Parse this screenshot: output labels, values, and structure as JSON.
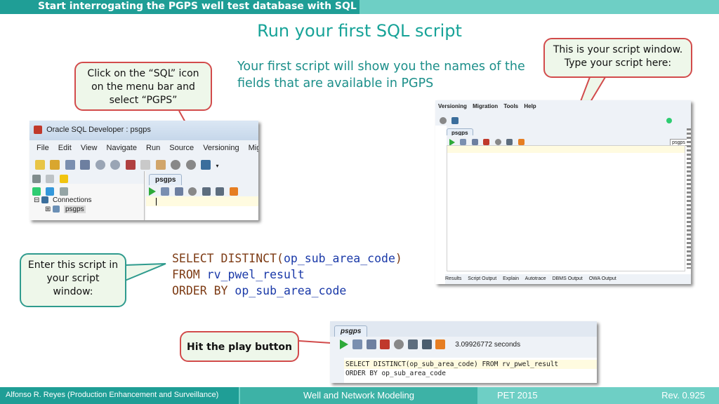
{
  "header": {
    "banner_title": "Start interrogating the PGPS well test database with SQL",
    "slide_title": "Run your first SQL script"
  },
  "intro_text": "Your first script will show you the names of the fields that are available in PGPS",
  "callouts": {
    "sql_icon": "Click on the “SQL” icon on the menu bar and select “PGPS”",
    "script_window": "This is your script window. Type your script here:",
    "enter_script": "Enter this script in your script window:",
    "play_button": "Hit the play button"
  },
  "sql_script": {
    "line1_kw": "SELECT DISTINCT(",
    "line1_field": "op_sub_area_code",
    "line1_end": ")",
    "line2_kw": "FROM ",
    "line2_table": "rv_pwel_result",
    "line3_kw": "ORDER BY ",
    "line3_field": "op_sub_area_code"
  },
  "left_screenshot": {
    "window_title": "Oracle SQL Developer : psgps",
    "menu": [
      "File",
      "Edit",
      "View",
      "Navigate",
      "Run",
      "Source",
      "Versioning",
      "Migration"
    ],
    "tab_label": "psgps",
    "tree_root": "Connections",
    "tree_child": "psgps"
  },
  "right_screenshot": {
    "menu": [
      "Versioning",
      "Migration",
      "Tools",
      "Help"
    ],
    "tab_label": "psgps",
    "connection_select": "psgps",
    "result_tabs": [
      "Results",
      "Script Output",
      "Explain",
      "Autotrace",
      "DBMS Output",
      "OWA Output"
    ]
  },
  "bottom_screenshot": {
    "tab_label": "psgps",
    "elapsed": "3.09926772 seconds",
    "code_line1": "SELECT DISTINCT(op_sub_area_code) FROM rv_pwel_result",
    "code_line2": "ORDER BY op_sub_area_code"
  },
  "footer": {
    "author": "Alfonso R. Reyes (Production Enhancement and Surveillance)",
    "course": "Well and Network Modeling",
    "event": "PET 2015",
    "revision": "Rev. 0.925"
  },
  "colors": {
    "teal_dark": "#1f9e96",
    "teal_light": "#6ecfc5",
    "callout_red": "#d24b4b",
    "sql_keyword": "#7d3b14",
    "sql_identifier": "#1a39a8"
  }
}
